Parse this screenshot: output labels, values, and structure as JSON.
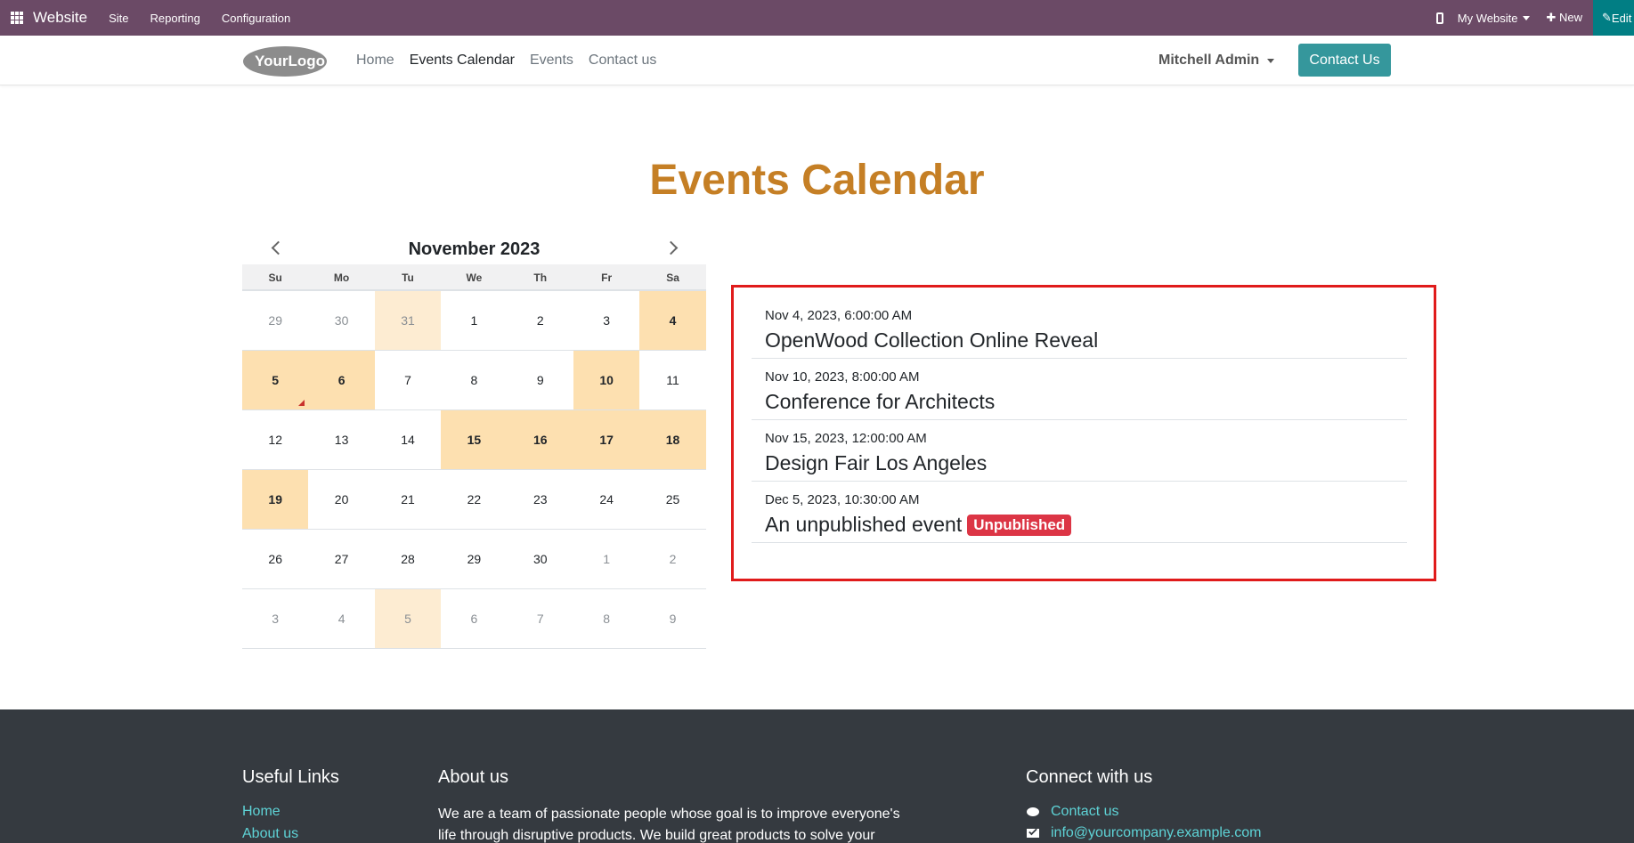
{
  "admin_bar": {
    "brand": "Website",
    "menus": [
      "Site",
      "Reporting",
      "Configuration"
    ],
    "my_website": "My Website",
    "new_label": "New",
    "edit_label": "Edit"
  },
  "header": {
    "logo_text": "YourLogo",
    "nav": [
      "Home",
      "Events Calendar",
      "Events",
      "Contact us"
    ],
    "active_nav": "Events Calendar",
    "user": "Mitchell Admin",
    "contact_button": "Contact Us"
  },
  "page": {
    "title": "Events Calendar"
  },
  "calendar": {
    "month_label": "November 2023",
    "weekdays": [
      "Su",
      "Mo",
      "Tu",
      "We",
      "Th",
      "Fr",
      "Sa"
    ],
    "weeks": [
      [
        {
          "d": "29",
          "m": 1
        },
        {
          "d": "30",
          "m": 1
        },
        {
          "d": "31",
          "m": 1,
          "l": 1
        },
        {
          "d": "1"
        },
        {
          "d": "2"
        },
        {
          "d": "3"
        },
        {
          "d": "4",
          "e": 1
        }
      ],
      [
        {
          "d": "5",
          "e": 1,
          "t": 1
        },
        {
          "d": "6",
          "e": 1
        },
        {
          "d": "7"
        },
        {
          "d": "8"
        },
        {
          "d": "9"
        },
        {
          "d": "10",
          "e": 1
        },
        {
          "d": "11"
        }
      ],
      [
        {
          "d": "12"
        },
        {
          "d": "13"
        },
        {
          "d": "14"
        },
        {
          "d": "15",
          "e": 1
        },
        {
          "d": "16",
          "e": 1
        },
        {
          "d": "17",
          "e": 1
        },
        {
          "d": "18",
          "e": 1
        }
      ],
      [
        {
          "d": "19",
          "e": 1
        },
        {
          "d": "20"
        },
        {
          "d": "21"
        },
        {
          "d": "22"
        },
        {
          "d": "23"
        },
        {
          "d": "24"
        },
        {
          "d": "25"
        }
      ],
      [
        {
          "d": "26"
        },
        {
          "d": "27"
        },
        {
          "d": "28"
        },
        {
          "d": "29"
        },
        {
          "d": "30"
        },
        {
          "d": "1",
          "m": 1
        },
        {
          "d": "2",
          "m": 1
        }
      ],
      [
        {
          "d": "3",
          "m": 1
        },
        {
          "d": "4",
          "m": 1
        },
        {
          "d": "5",
          "m": 1,
          "l": 1
        },
        {
          "d": "6",
          "m": 1
        },
        {
          "d": "7",
          "m": 1
        },
        {
          "d": "8",
          "m": 1
        },
        {
          "d": "9",
          "m": 1
        }
      ]
    ]
  },
  "events": [
    {
      "date": "Nov 4, 2023, 6:00:00 AM",
      "title": "OpenWood Collection Online Reveal",
      "badge": ""
    },
    {
      "date": "Nov 10, 2023, 8:00:00 AM",
      "title": "Conference for Architects",
      "badge": ""
    },
    {
      "date": "Nov 15, 2023, 12:00:00 AM",
      "title": "Design Fair Los Angeles",
      "badge": ""
    },
    {
      "date": "Dec 5, 2023, 10:30:00 AM",
      "title": "An unpublished event",
      "badge": "Unpublished"
    }
  ],
  "footer": {
    "useful_links_title": "Useful Links",
    "useful_links": [
      "Home",
      "About us"
    ],
    "about_title": "About us",
    "about_text": "We are a team of passionate people whose goal is to improve everyone's life through disruptive products. We build great products to solve your",
    "connect_title": "Connect with us",
    "connect_items": [
      {
        "icon": "chat-icon",
        "label": "Contact us"
      },
      {
        "icon": "envelope-icon",
        "label": "info@yourcompany.example.com"
      }
    ]
  }
}
